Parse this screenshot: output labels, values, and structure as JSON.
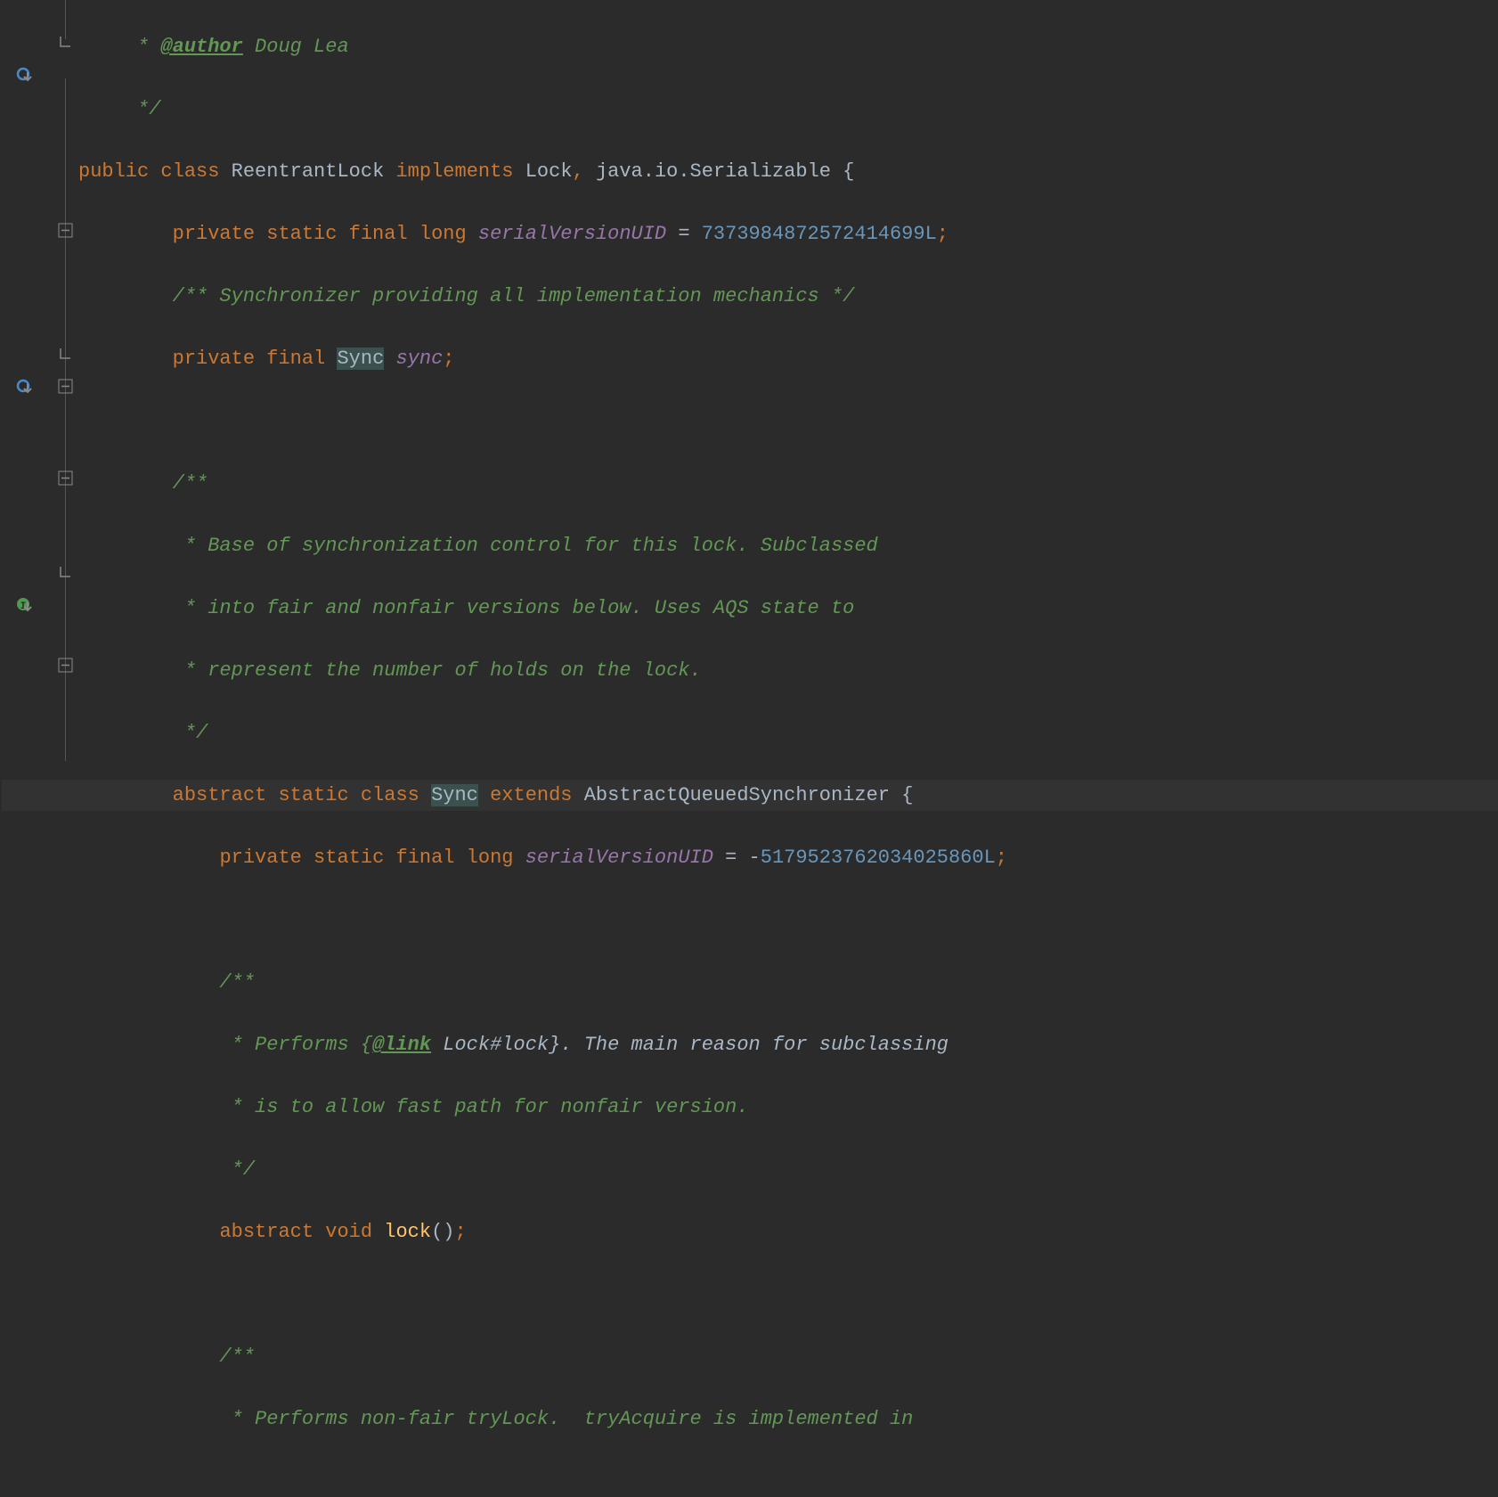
{
  "lines": {
    "l0": {
      "pre": "     * ",
      "tag": "@author",
      "rest": " Doug Lea"
    },
    "l1": "     */",
    "l2": {
      "kw1": "public class ",
      "cls1": "ReentrantLock ",
      "kw2": "implements ",
      "cls2": "Lock",
      "p1": ", ",
      "cls3": "java.io.Serializable ",
      "brace": "{"
    },
    "l3": {
      "pad": "        ",
      "kw": "private static final long ",
      "field": "serialVersionUID",
      "eq": " = ",
      "num": "7373984872572414699L",
      "semi": ";"
    },
    "l4": "        /** Synchronizer providing all implementation mechanics */",
    "l5": {
      "pad": "        ",
      "kw": "private final ",
      "type": "Sync",
      "sp": " ",
      "field": "sync",
      "semi": ";"
    },
    "l6": "",
    "l7": "        /**",
    "l8": "         * Base of synchronization control for this lock. Subclassed",
    "l9": "         * into fair and nonfair versions below. Uses AQS state to",
    "l10": "         * represent the number of holds on the lock.",
    "l11": "         */",
    "l12": {
      "pad": "        ",
      "kw1": "abstract static class ",
      "type": "Sync",
      "sp": " ",
      "kw2": "extends ",
      "cls": "AbstractQueuedSynchronizer ",
      "brace": "{"
    },
    "l13": {
      "pad": "            ",
      "kw": "private static final long ",
      "field": "serialVersionUID",
      "eq": " = ",
      "minus": "-",
      "num": "5179523762034025860L",
      "semi": ";"
    },
    "l14": "",
    "l15": "            /**",
    "l16": {
      "pre": "             * Performs {",
      "tag": "@link",
      "rest": " Lock#lock}. The main reason for subclassing"
    },
    "l17": "             * is to allow fast path for nonfair version.",
    "l18": "             */",
    "l19": {
      "pad": "            ",
      "kw": "abstract void ",
      "method": "lock",
      "paren": "()",
      "semi": ";"
    },
    "l20": "",
    "l21": "            /**",
    "l22": "             * Performs non-fair tryLock.  tryAcquire is implemented in"
  },
  "icons": {
    "override": "override-down-icon",
    "implement": "implement-down-icon",
    "fold_end": "fold-end-icon",
    "fold_minus": "fold-minus-icon"
  }
}
